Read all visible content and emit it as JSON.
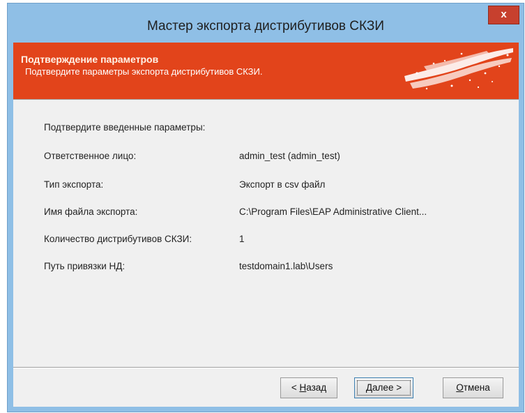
{
  "window": {
    "title": "Мастер экспорта дистрибутивов СКЗИ",
    "close_label": "x"
  },
  "banner": {
    "title": "Подтверждение параметров",
    "subtitle": "Подтвердите параметры экспорта дистрибутивов СКЗИ."
  },
  "content": {
    "intro": "Подтвердите введенные параметры:",
    "params": [
      {
        "label": "Ответственное лицо:",
        "value": "admin_test (admin_test)"
      },
      {
        "label": "Тип экспорта:",
        "value": "Экспорт в csv файл"
      },
      {
        "label": "Имя файла экспорта:",
        "value": "C:\\Program Files\\EAP Administrative Client..."
      },
      {
        "label": "Количество дистрибутивов СКЗИ:",
        "value": "1"
      },
      {
        "label": "Путь привязки НД:",
        "value": "testdomain1.lab\\Users"
      }
    ]
  },
  "buttons": {
    "back": {
      "prefix": "< ",
      "mnemonic": "Н",
      "rest": "азад"
    },
    "next": {
      "prefix": "",
      "mnemonic": "Д",
      "rest": "алее >"
    },
    "cancel": {
      "prefix": "",
      "mnemonic": "О",
      "rest": "тмена"
    }
  },
  "colors": {
    "banner": "#e2441b",
    "titlebar": "#8fbfe6",
    "close_button": "#c7402e"
  }
}
